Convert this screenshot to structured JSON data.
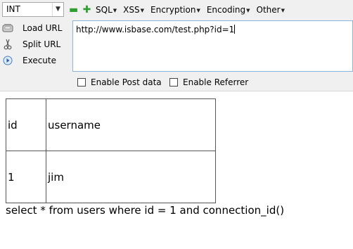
{
  "toolbar": {
    "select_value": "INT",
    "menu": [
      {
        "label": "SQL"
      },
      {
        "label": "XSS"
      },
      {
        "label": "Encryption"
      },
      {
        "label": "Encoding"
      },
      {
        "label": "Other"
      }
    ],
    "load_url": "Load URL",
    "split_url": "Split URL",
    "execute": "Execute",
    "url_value": "http://www.isbase.com/test.php?id=1",
    "enable_post": "Enable Post data",
    "enable_referrer": "Enable Referrer"
  },
  "result": {
    "rows": [
      [
        "id",
        "username"
      ],
      [
        "1",
        "jim"
      ]
    ],
    "query": "select * from users where id = 1 and connection_id()"
  },
  "colors": {
    "toolbar_bg": "#f0f0f0",
    "url_border": "#8cb5d9",
    "icon_green": "#2f9e2f"
  }
}
